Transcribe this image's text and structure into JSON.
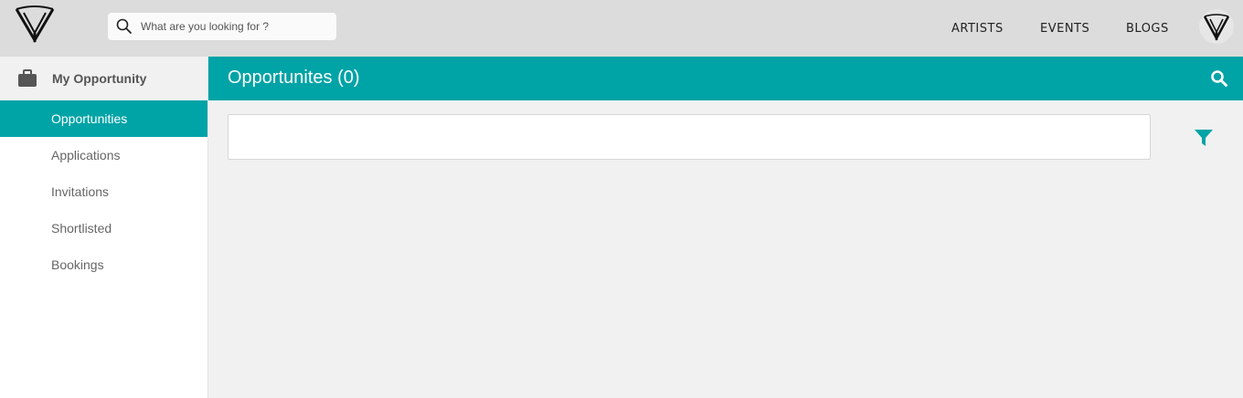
{
  "header": {
    "search_placeholder": "What are you looking for ?",
    "nav": {
      "artists": "ARTISTS",
      "events": "EVENTS",
      "blogs": "BLOGS"
    },
    "icons": {
      "logo": "y-logo-icon",
      "search": "search-icon",
      "avatar": "user-avatar"
    }
  },
  "sidebar": {
    "section_title": "My Opportunity",
    "section_icon": "briefcase-icon",
    "items": [
      {
        "label": "Opportunities",
        "active": true
      },
      {
        "label": "Applications",
        "active": false
      },
      {
        "label": "Invitations",
        "active": false
      },
      {
        "label": "Shortlisted",
        "active": false
      },
      {
        "label": "Bookings",
        "active": false
      }
    ]
  },
  "main": {
    "title": "Opportunites (0)",
    "header_icon": "search-icon",
    "filter_icon": "filter-icon"
  },
  "colors": {
    "accent": "#00a3a6",
    "topbar": "#dcdcdc",
    "background": "#f1f1f1"
  }
}
